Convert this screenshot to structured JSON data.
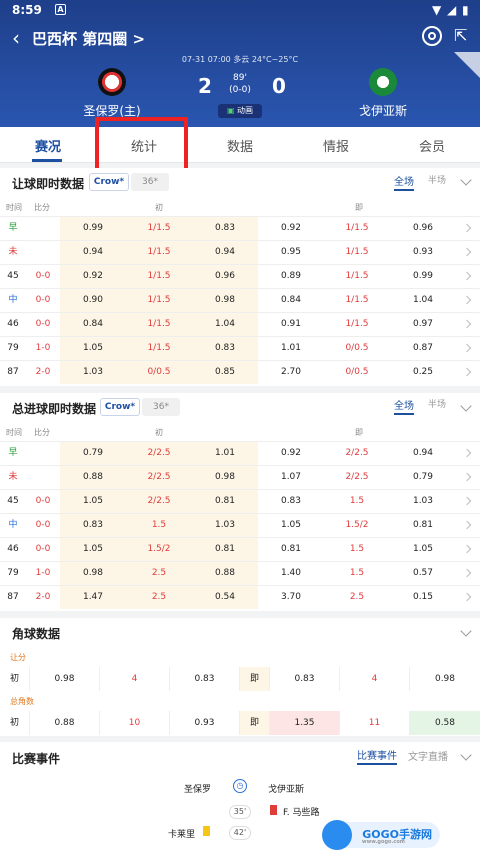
{
  "status_bar": {
    "time": "8:59",
    "badge": "A"
  },
  "nav": {
    "title": "巴西杯 第四圈 >"
  },
  "match": {
    "info": "07-31 07:00  多云 24°C~25°C",
    "home": "圣保罗(主)",
    "away": "戈伊亚斯",
    "home_score": "2",
    "away_score": "0",
    "minute": "89'",
    "half_score": "(0-0)",
    "anim_label": "动画",
    "colors": {
      "header": "#2a56b0",
      "accent": "#1e50a2"
    }
  },
  "tabs": [
    "赛况",
    "统计",
    "数据",
    "情报",
    "会员"
  ],
  "handicap": {
    "title": "让球即时数据",
    "company": "Crow*",
    "company2": "36*",
    "full": "全场",
    "half": "半场",
    "headers": {
      "time": "时间",
      "score": "比分",
      "init": "初",
      "live": "即"
    },
    "rows": [
      {
        "t": "早",
        "s": "",
        "v": [
          "0.99",
          "1/1.5",
          "0.83",
          "0.92",
          "1/1.5",
          "0.96"
        ]
      },
      {
        "t": "未",
        "s": "",
        "v": [
          "0.94",
          "1/1.5",
          "0.94",
          "0.95",
          "1/1.5",
          "0.93"
        ]
      },
      {
        "t": "45",
        "s": "0-0",
        "v": [
          "0.92",
          "1/1.5",
          "0.96",
          "0.89",
          "1/1.5",
          "0.99"
        ]
      },
      {
        "t": "中",
        "s": "0-0",
        "v": [
          "0.90",
          "1/1.5",
          "0.98",
          "0.84",
          "1/1.5",
          "1.04"
        ]
      },
      {
        "t": "46",
        "s": "0-0",
        "v": [
          "0.84",
          "1/1.5",
          "1.04",
          "0.91",
          "1/1.5",
          "0.97"
        ]
      },
      {
        "t": "79",
        "s": "1-0",
        "v": [
          "1.05",
          "1/1.5",
          "0.83",
          "1.01",
          "0/0.5",
          "0.87"
        ]
      },
      {
        "t": "87",
        "s": "2-0",
        "v": [
          "1.03",
          "0/0.5",
          "0.85",
          "2.70",
          "0/0.5",
          "0.25"
        ]
      }
    ]
  },
  "totals": {
    "title": "总进球即时数据",
    "company": "Crow*",
    "company2": "36*",
    "full": "全场",
    "half": "半场",
    "headers": {
      "time": "时间",
      "score": "比分",
      "init": "初",
      "live": "即"
    },
    "rows": [
      {
        "t": "早",
        "s": "",
        "v": [
          "0.79",
          "2/2.5",
          "1.01",
          "0.92",
          "2/2.5",
          "0.94"
        ]
      },
      {
        "t": "未",
        "s": "",
        "v": [
          "0.88",
          "2/2.5",
          "0.98",
          "1.07",
          "2/2.5",
          "0.79"
        ]
      },
      {
        "t": "45",
        "s": "0-0",
        "v": [
          "1.05",
          "2/2.5",
          "0.81",
          "0.83",
          "1.5",
          "1.03"
        ]
      },
      {
        "t": "中",
        "s": "0-0",
        "v": [
          "0.83",
          "1.5",
          "1.03",
          "1.05",
          "1.5/2",
          "0.81"
        ]
      },
      {
        "t": "46",
        "s": "0-0",
        "v": [
          "1.05",
          "1.5/2",
          "0.81",
          "0.81",
          "1.5",
          "1.05"
        ]
      },
      {
        "t": "79",
        "s": "1-0",
        "v": [
          "0.98",
          "2.5",
          "0.88",
          "1.40",
          "1.5",
          "0.57"
        ]
      },
      {
        "t": "87",
        "s": "2-0",
        "v": [
          "1.47",
          "2.5",
          "0.54",
          "3.70",
          "2.5",
          "0.15"
        ]
      }
    ]
  },
  "corners": {
    "title": "角球数据",
    "hcp_label": "让分",
    "total_label": "总角数",
    "hcp": {
      "init_label": "初",
      "init": [
        "0.98",
        "4",
        "0.83"
      ],
      "live_label": "即",
      "live": [
        "0.83",
        "4",
        "0.98"
      ]
    },
    "total": {
      "init_label": "初",
      "init": [
        "0.88",
        "10",
        "0.93"
      ],
      "live_label": "即",
      "live": [
        "1.35",
        "11",
        "0.58"
      ]
    }
  },
  "events": {
    "title": "比赛事件",
    "tab1": "比赛事件",
    "tab2": "文字直播",
    "home": "圣保罗",
    "away": "戈伊亚斯",
    "list": [
      {
        "min": "35'",
        "side": "away",
        "text": "F. 马些路",
        "card": "red"
      },
      {
        "min": "42'",
        "side": "home",
        "text": "卡莱里",
        "card": "yellow"
      }
    ]
  },
  "watermark": {
    "text": "GOGO手游网",
    "sub": "www.gogo.com"
  }
}
